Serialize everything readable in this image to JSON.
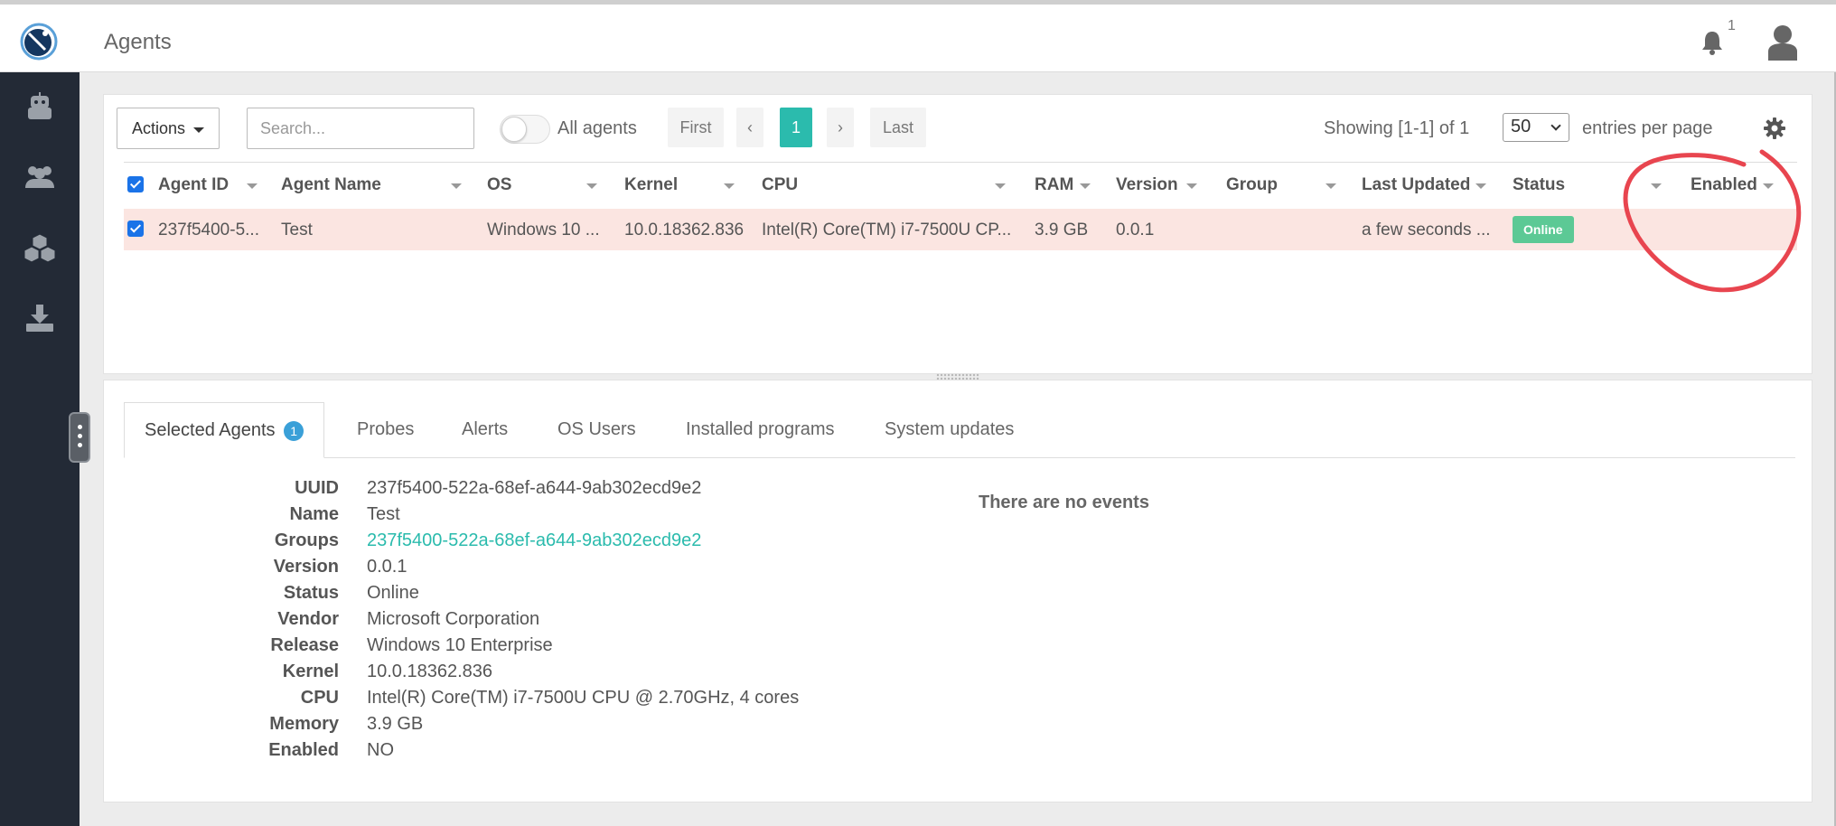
{
  "header": {
    "title": "Agents",
    "notification_count": "1"
  },
  "sidebar": {
    "items": [
      "robot-icon",
      "users-icon",
      "cubes-icon",
      "download-icon"
    ]
  },
  "toolbar": {
    "actions_label": "Actions",
    "search_placeholder": "Search...",
    "all_agents_label": "All agents",
    "pagination": {
      "first": "First",
      "prev": "‹",
      "current": "1",
      "next": "›",
      "last": "Last"
    },
    "showing": "Showing [1-1] of 1",
    "per_page_value": "50",
    "per_page_label": "entries per page"
  },
  "table": {
    "columns": [
      "Agent ID",
      "Agent Name",
      "OS",
      "Kernel",
      "CPU",
      "RAM",
      "Version",
      "Group",
      "Last Updated",
      "Status",
      "Enabled"
    ],
    "rows": [
      {
        "agent_id": "237f5400-5...",
        "agent_name": "Test",
        "os": "Windows 10 ...",
        "kernel": "10.0.18362.836",
        "cpu": "Intel(R) Core(TM) i7-7500U CP...",
        "ram": "3.9 GB",
        "version": "0.0.1",
        "group": "",
        "last_updated": "a few seconds ...",
        "status": "Online",
        "enabled": ""
      }
    ]
  },
  "tabs": [
    {
      "label": "Selected Agents",
      "badge": "1"
    },
    {
      "label": "Probes"
    },
    {
      "label": "Alerts"
    },
    {
      "label": "OS Users"
    },
    {
      "label": "Installed programs"
    },
    {
      "label": "System updates"
    }
  ],
  "details": {
    "uuid_label": "UUID",
    "uuid": "237f5400-522a-68ef-a644-9ab302ecd9e2",
    "name_label": "Name",
    "name": "Test",
    "groups_label": "Groups",
    "groups": "237f5400-522a-68ef-a644-9ab302ecd9e2",
    "version_label": "Version",
    "version": "0.0.1",
    "status_label": "Status",
    "status": "Online",
    "vendor_label": "Vendor",
    "vendor": "Microsoft Corporation",
    "release_label": "Release",
    "release": "Windows 10 Enterprise",
    "kernel_label": "Kernel",
    "kernel": "10.0.18362.836",
    "cpu_label": "CPU",
    "cpu": "Intel(R) Core(TM) i7-7500U CPU @ 2.70GHz, 4 cores",
    "memory_label": "Memory",
    "memory": "3.9 GB",
    "enabled_label": "Enabled",
    "enabled": "NO"
  },
  "events": {
    "empty_message": "There are no events"
  },
  "colors": {
    "accent": "#2bbbad",
    "sidebar": "#232a36",
    "row_highlight": "#fbe5e1",
    "online": "#5cc995",
    "annotation": "#e8454f"
  }
}
